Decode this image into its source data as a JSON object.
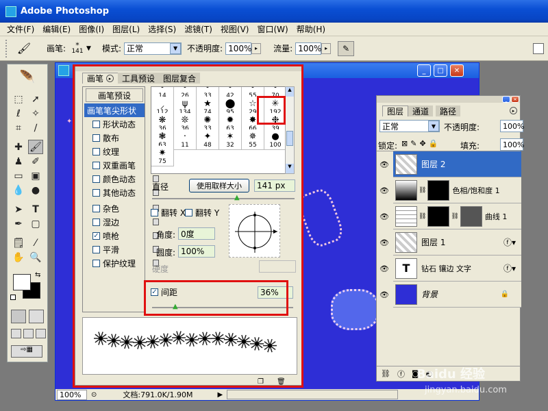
{
  "app": {
    "title": "Adobe Photoshop"
  },
  "menu": [
    "文件(F)",
    "编辑(E)",
    "图像(I)",
    "图层(L)",
    "选择(S)",
    "滤镜(T)",
    "视图(V)",
    "窗口(W)",
    "帮助(H)"
  ],
  "options": {
    "brush_label": "画笔:",
    "brush_size": "141",
    "mode_label": "模式:",
    "mode_value": "正常",
    "opacity_label": "不透明度:",
    "opacity_value": "100%",
    "flow_label": "流量:",
    "flow_value": "100%"
  },
  "document": {
    "zoom": "100%",
    "doc_info": "文档:791.0K/1.90M"
  },
  "brushes_panel": {
    "tabs": [
      "画笔",
      "工具预设",
      "图层复合"
    ],
    "list": [
      {
        "label": "画笔预设",
        "type": "header"
      },
      {
        "label": "画笔笔尖形状",
        "type": "selected"
      },
      {
        "label": "形状动态",
        "checked": false
      },
      {
        "label": "散布",
        "checked": false
      },
      {
        "label": "纹理",
        "checked": false
      },
      {
        "label": "双重画笔",
        "checked": false
      },
      {
        "label": "颜色动态",
        "checked": false
      },
      {
        "label": "其他动态",
        "checked": false
      },
      {
        "label": "杂色",
        "checked": false
      },
      {
        "label": "湿边",
        "checked": false
      },
      {
        "label": "喷枪",
        "checked": true
      },
      {
        "label": "平滑",
        "checked": false
      },
      {
        "label": "保护纹理",
        "checked": false
      }
    ],
    "tip_sizes": [
      "14",
      "26",
      "33",
      "42",
      "55",
      "70",
      "112",
      "134",
      "74",
      "95",
      "29",
      "192",
      "36",
      "36",
      "33",
      "63",
      "66",
      "39",
      "63",
      "11",
      "48",
      "32",
      "55",
      "100",
      "75"
    ],
    "diameter_label": "直径",
    "use_sample_button": "使用取样大小",
    "diameter_value": "141 px",
    "flip_x": "翻转 X",
    "flip_y": "翻转 Y",
    "angle_label": "角度:",
    "angle_value": "0度",
    "roundness_label": "圆度:",
    "roundness_value": "100%",
    "hardness_label": "硬度",
    "spacing_label": "间距",
    "spacing_value": "36%",
    "spacing_checked": true
  },
  "layers_panel": {
    "tabs": [
      "图层",
      "通道",
      "路径"
    ],
    "blend_mode": "正常",
    "opacity_label": "不透明度:",
    "opacity_value": "100%",
    "lock_label": "锁定:",
    "fill_label": "填充:",
    "fill_value": "100%",
    "layers": [
      {
        "name": "图层 2",
        "selected": true
      },
      {
        "name": "色相/饱和度 1"
      },
      {
        "name": "曲线 1"
      },
      {
        "name": "图层 1"
      },
      {
        "name": "钻石 镶边 文字"
      },
      {
        "name": "背景"
      }
    ]
  },
  "watermark": {
    "brand": "Baidu 经验",
    "url": "jingyan.baidu.com"
  },
  "colors": {
    "accent": "#316ac5",
    "highlight": "#e01010",
    "canvas": "#2e2ed6"
  }
}
